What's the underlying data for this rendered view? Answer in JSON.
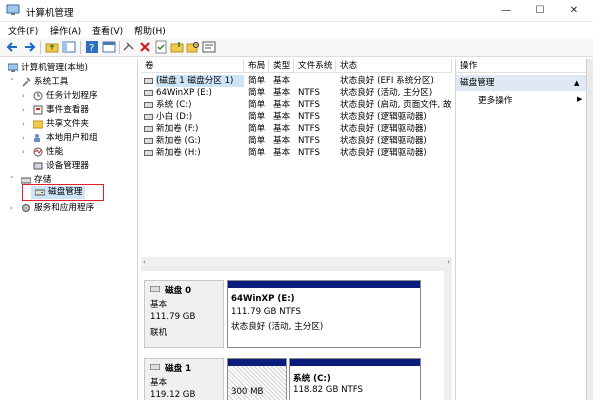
{
  "window": {
    "title": "计算机管理",
    "min": "—",
    "max": "☐",
    "close": "✕"
  },
  "menu": [
    "文件(F)",
    "操作(A)",
    "查看(V)",
    "帮助(H)"
  ],
  "tree": {
    "root": "计算机管理(本地)",
    "system_tools": "系统工具",
    "task_scheduler": "任务计划程序",
    "event_viewer": "事件查看器",
    "shared_folders": "共享文件夹",
    "local_users": "本地用户和组",
    "performance": "性能",
    "device_manager": "设备管理器",
    "storage": "存储",
    "disk_management": "磁盘管理",
    "services": "服务和应用程序"
  },
  "volume_table": {
    "headers": [
      "卷",
      "布局",
      "类型",
      "文件系统",
      "状态"
    ],
    "rows": [
      [
        "(磁盘 1 磁盘分区 1)",
        "简单",
        "基本",
        "",
        "状态良好 (EFI 系统分区)"
      ],
      [
        "64WinXP (E:)",
        "简单",
        "基本",
        "NTFS",
        "状态良好 (活动, 主分区)"
      ],
      [
        "系统 (C:)",
        "简单",
        "基本",
        "NTFS",
        "状态良好 (启动, 页面文件, 故障"
      ],
      [
        "小白 (D:)",
        "简单",
        "基本",
        "NTFS",
        "状态良好 (逻辑驱动器)"
      ],
      [
        "新加卷 (F:)",
        "简单",
        "基本",
        "NTFS",
        "状态良好 (逻辑驱动器)"
      ],
      [
        "新加卷 (G:)",
        "简单",
        "基本",
        "NTFS",
        "状态良好 (逻辑驱动器)"
      ],
      [
        "新加卷 (H:)",
        "简单",
        "基本",
        "NTFS",
        "状态良好 (逻辑驱动器)"
      ]
    ]
  },
  "disks": [
    {
      "name": "磁盘 0",
      "type": "基本",
      "size": "111.79 GB",
      "status": "联机",
      "partition": {
        "name": "64WinXP  (E:)",
        "size": "111.79 GB NTFS",
        "status": "状态良好 (活动, 主分区)"
      }
    },
    {
      "name": "磁盘 1",
      "type": "基本",
      "size": "119.12 GB",
      "partition_small": {
        "size": "300 MB"
      },
      "partition": {
        "name": "系统  (C:)",
        "size": "118.82 GB NTFS"
      }
    }
  ],
  "actions": {
    "header": "操作",
    "section": "磁盘管理",
    "more": "更多操作"
  },
  "colors": {
    "selection": "#cde4f7",
    "highlight_border": "#e0202a",
    "partition_bar": "#0a1d7d"
  }
}
